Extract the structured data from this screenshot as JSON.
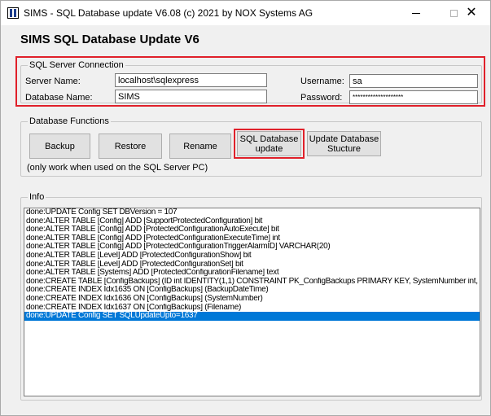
{
  "window": {
    "title": "SIMS - SQL Database update V6.08  (c) 2021 by NOX Systems AG",
    "minimize": "—",
    "close": "✕"
  },
  "heading": "SIMS SQL Database Update V6",
  "connection": {
    "legend": "SQL Server Connection",
    "server_label": "Server Name:",
    "server_value": "localhost\\sqlexpress",
    "database_label": "Database Name:",
    "database_value": "SIMS",
    "username_label": "Username:",
    "username_value": "sa",
    "password_label": "Password:",
    "password_value": "********************"
  },
  "functions": {
    "legend": "Database Functions",
    "backup": "Backup",
    "restore": "Restore",
    "rename": "Rename",
    "sql_update_line1": "SQL Database",
    "sql_update_line2": "update",
    "update_structure_line1": "Update Database",
    "update_structure_line2": "Stucture",
    "note": "(only work when used on the SQL Server PC)"
  },
  "info": {
    "legend": "Info",
    "lines": [
      "done:UPDATE Config SET DBVersion = 107",
      "done:ALTER TABLE [Config] ADD [SupportProtectedConfiguration] bit",
      "done:ALTER TABLE [Config] ADD [ProtectedConfigurationAutoExecute] bit",
      "done:ALTER TABLE [Config] ADD [ProtectedConfigurationExecuteTime] int",
      "done:ALTER TABLE [Config] ADD [ProtectedConfigurationTriggerAlarmID] VARCHAR(20)",
      "done:ALTER TABLE [Level] ADD [ProtectedConfigurationShow] bit",
      "done:ALTER TABLE [Level] ADD [ProtectedConfigurationSet] bit",
      "done:ALTER TABLE [Systems] ADD [ProtectedConfigurationFilename] text",
      "done:CREATE TABLE [ConfigBackups] (ID int IDENTITY(1,1) CONSTRAINT PK_ConfigBackups PRIMARY KEY, SystemNumber int,",
      "done:CREATE INDEX Idx1635 ON [ConfigBackups] (BackupDateTime)",
      "done:CREATE INDEX Idx1636 ON [ConfigBackups] (SystemNumber)",
      "done:CREATE INDEX Idx1637 ON [ConfigBackups] (Filename)",
      "done:UPDATE Config SET SQLUpdateUpto=1637"
    ],
    "selected_index": 12
  },
  "colors": {
    "highlight_border": "#e0202a",
    "selection": "#0078d7"
  }
}
